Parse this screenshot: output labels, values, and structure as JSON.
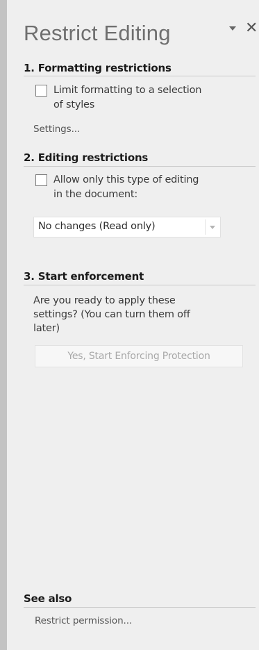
{
  "pane": {
    "title": "Restrict Editing"
  },
  "formatting": {
    "heading": "1. Formatting restrictions",
    "checkbox_line1": "Limit formatting to a selection",
    "checkbox_line2": "of styles",
    "settings_link": "Settings..."
  },
  "editing": {
    "heading": "2. Editing restrictions",
    "checkbox_line1": "Allow only this type of editing",
    "checkbox_line2": "in the document:",
    "dropdown_value": "No changes (Read only)"
  },
  "enforcement": {
    "heading": "3. Start enforcement",
    "description_line1": "Are you ready to apply these",
    "description_line2": "settings? (You can turn them off",
    "description_line3": "later)",
    "button_label": "Yes, Start Enforcing Protection"
  },
  "see_also": {
    "heading": "See also",
    "link": "Restrict permission..."
  },
  "icons": {
    "menu": "chevron-down-icon",
    "close": "close-icon",
    "dropdown": "dropdown-arrow-icon"
  }
}
